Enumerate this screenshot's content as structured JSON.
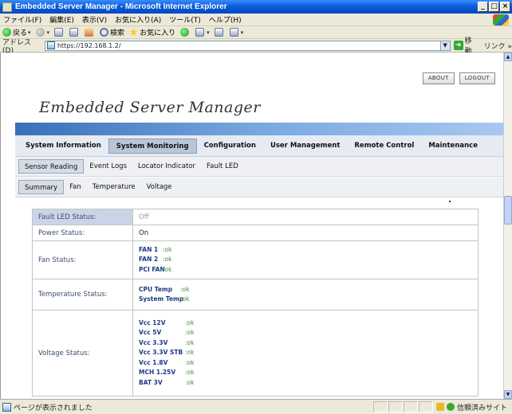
{
  "window": {
    "title": "Embedded Server Manager - Microsoft Internet Explorer"
  },
  "menubar": [
    "ファイル(F)",
    "編集(E)",
    "表示(V)",
    "お気に入り(A)",
    "ツール(T)",
    "ヘルプ(H)"
  ],
  "toolbar": {
    "back": "戻る",
    "search": "検索",
    "favorites": "お気に入り"
  },
  "address": {
    "label": "アドレス(D)",
    "url": "https://192.168.1.2/",
    "go": "移動",
    "links": "リンク »"
  },
  "page": {
    "about": "ABOUT",
    "logout": "LOGOUT",
    "brand": "Embedded Server Manager",
    "main_tabs": [
      "System Information",
      "System Monitoring",
      "Configuration",
      "User Management",
      "Remote Control",
      "Maintenance"
    ],
    "sub_tabs": [
      "Sensor Reading",
      "Event Logs",
      "Locator Indicator",
      "Fault LED"
    ],
    "sub_tabs2": [
      "Summary",
      "Fan",
      "Temperature",
      "Voltage"
    ]
  },
  "status": {
    "fault_led": {
      "label": "Fault LED Status:",
      "value": "Off"
    },
    "power": {
      "label": "Power Status:",
      "value": "On"
    },
    "fan": {
      "label": "Fan Status:",
      "items": [
        {
          "k": "FAN 1",
          "v": ":ok"
        },
        {
          "k": "FAN 2",
          "v": ":ok"
        },
        {
          "k": "PCI FAN",
          "v": ":ok"
        }
      ]
    },
    "temperature": {
      "label": "Temperature Status:",
      "items": [
        {
          "k": "CPU Temp",
          "v": ":ok"
        },
        {
          "k": "System Temp",
          "v": ":ok"
        }
      ]
    },
    "voltage": {
      "label": "Voltage Status:",
      "items": [
        {
          "k": "Vcc 12V",
          "v": ":ok"
        },
        {
          "k": "Vcc 5V",
          "v": ":ok"
        },
        {
          "k": "Vcc 3.3V",
          "v": ":ok"
        },
        {
          "k": "Vcc 3.3V STB",
          "v": ":ok"
        },
        {
          "k": "Vcc 1.8V",
          "v": ":ok"
        },
        {
          "k": "MCH 1.25V",
          "v": ":ok"
        },
        {
          "k": "BAT 3V",
          "v": ":ok"
        }
      ]
    }
  },
  "statusbar": {
    "message": "ページが表示されました",
    "zone": "信頼済みサイト"
  }
}
